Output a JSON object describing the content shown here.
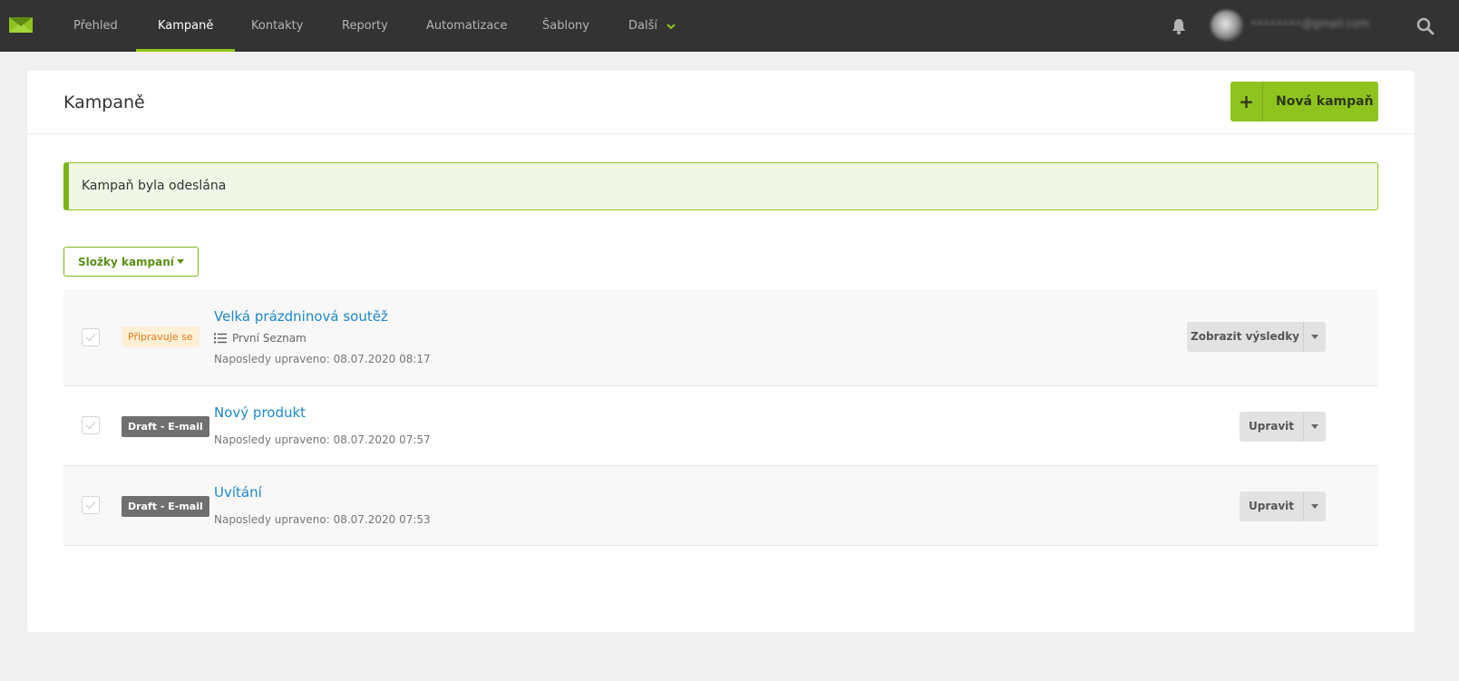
{
  "nav": {
    "items": [
      "Přehled",
      "Kampaně",
      "Kontakty",
      "Reporty",
      "Automatizace",
      "Šablony",
      "Další"
    ],
    "active": "Kampaně"
  },
  "user": {
    "email": "••••••••@gmail.com"
  },
  "page": {
    "title": "Kampaně",
    "new_campaign_label": "Nová kampaň",
    "alert": "Kampaň byla odeslána",
    "folders_label": "Složky kampaní"
  },
  "campaigns": [
    {
      "status": "Připravuje se",
      "title": "Velká prázdninová soutěž",
      "list": "První Seznam",
      "updated": "Naposledy upraveno: 08.07.2020 08:17",
      "action": "Zobrazit výsledky"
    },
    {
      "status": "Draft - E-mail",
      "title": "Nový produkt",
      "updated": "Naposledy upraveno: 08.07.2020 07:57",
      "action": "Upravit"
    },
    {
      "status": "Draft - E-mail",
      "title": "Uvítání",
      "updated": "Naposledy upraveno: 08.07.2020 07:53",
      "action": "Upravit"
    }
  ],
  "colors": {
    "topbar": "#333333",
    "accent": "#8fc41f",
    "link": "#1e88c9",
    "badge_preparing_bg": "#fdf0d6",
    "badge_preparing_text": "#e8781c",
    "badge_draft_bg": "#707070"
  },
  "icons": [
    "mail-logo-icon",
    "chevron-down-icon",
    "bell-icon",
    "search-icon",
    "plus-icon",
    "list-icon",
    "check-icon",
    "caret-down-icon"
  ]
}
